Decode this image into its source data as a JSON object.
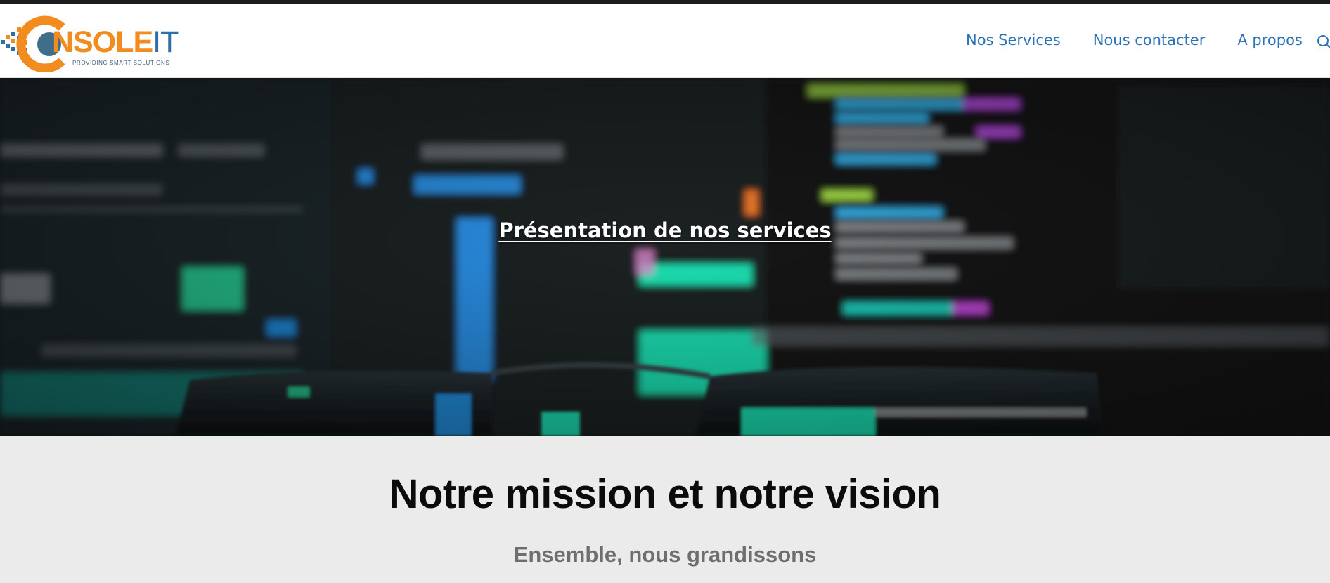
{
  "brand": {
    "logo_text_main": "NSOLE",
    "logo_text_accent": "IT",
    "tagline": "PROVIDING SMART SOLUTIONS",
    "primary_color": "#f28c1e",
    "secondary_color": "#2f6fa6"
  },
  "nav": {
    "items": [
      {
        "label": "Nos Services"
      },
      {
        "label": "Nous contacter"
      },
      {
        "label": "A propos"
      }
    ],
    "search_icon": "search-icon",
    "link_color": "#2b72b8"
  },
  "hero": {
    "link_text": "Présentation de nos services",
    "background": "blurred code editor screen seen through eyeglasses"
  },
  "mission": {
    "title": "Notre mission et notre vision",
    "subtitle": "Ensemble, nous grandissons"
  }
}
